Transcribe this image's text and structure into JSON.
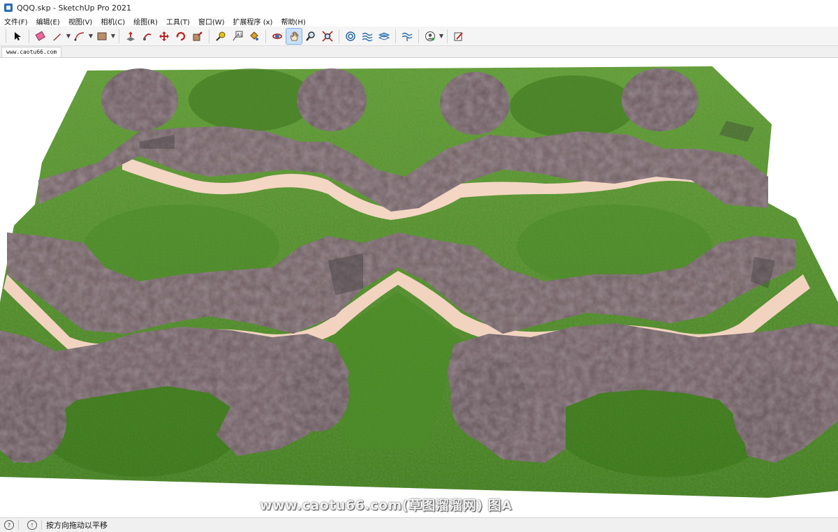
{
  "window": {
    "title": "QQQ.skp - SketchUp Pro 2021"
  },
  "menu": [
    "文件(F)",
    "编辑(E)",
    "视图(V)",
    "相机(C)",
    "绘图(R)",
    "工具(T)",
    "窗口(W)",
    "扩展程序 (x)",
    "帮助(H)"
  ],
  "toolbar": {
    "icons": [
      "select-icon",
      "eraser-icon",
      "pencil-icon",
      "arc-icon",
      "rectangle-icon",
      "pushpull-icon",
      "follow-me-icon",
      "move-icon",
      "rotate-icon",
      "scale-icon",
      "tape-measure-icon",
      "text-icon",
      "paint-bucket-icon",
      "orbit-icon",
      "pan-icon",
      "zoom-icon",
      "zoom-extents-icon",
      "sandbox-smoove-icon",
      "sandbox-stamp-icon",
      "sandbox-drape-icon",
      "sandbox-flip-icon",
      "account-icon",
      "extension-warehouse-icon"
    ]
  },
  "tabs": [
    {
      "label": "www.caotu66.com"
    }
  ],
  "viewport": {
    "watermark": "www.caotu66.com(草图溜溜网) 图A"
  },
  "status": {
    "hint": "按方向拖动以平移"
  },
  "colors": {
    "grass": "#4e8a2a",
    "rock": "#6f5f63",
    "path": "#f3d6c3",
    "active_tool": "#c9e0f7"
  }
}
